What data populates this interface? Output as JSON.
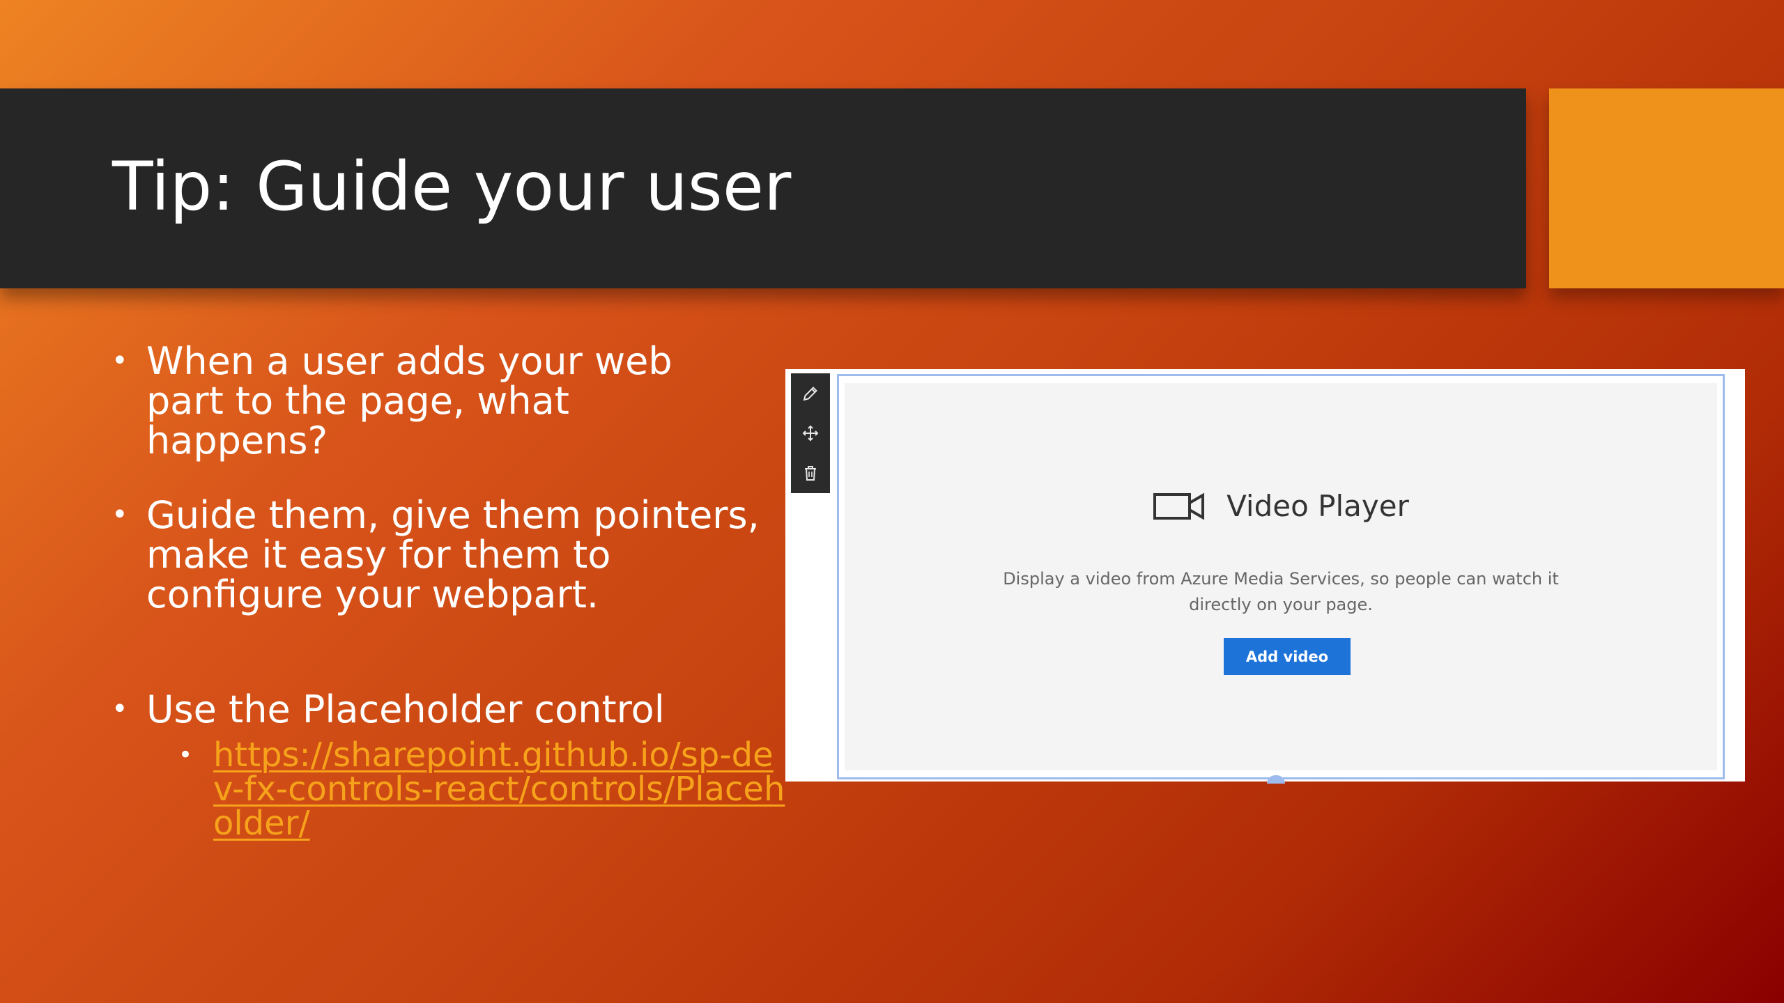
{
  "slide": {
    "title": "Tip: Guide your user",
    "colors": {
      "background_start": "#ee8323",
      "background_end": "#8a0000",
      "title_bar": "#262626",
      "accent_block": "#ef921b",
      "link": "#f7a21b"
    }
  },
  "bullets": [
    {
      "marker": "•",
      "text": "When a user adds your web part to the page, what happens?"
    },
    {
      "marker": "•",
      "text": "Guide them, give them pointers, make it easy for them to configure your webpart."
    },
    {
      "marker": "•",
      "text": "Use the Placeholder control"
    }
  ],
  "sub_bullet": {
    "marker": "•",
    "link_text": "https://sharepoint.github.io/sp-dev-fx-controls-react/controls/Placeholder/"
  },
  "screenshot": {
    "toolbar": {
      "icons": [
        "pencil-icon",
        "move-icon",
        "trash-icon"
      ]
    },
    "placeholder": {
      "icon": "video-camera-icon",
      "title": "Video Player",
      "description": "Display a video from Azure Media Services, so people can watch it directly on your page.",
      "button_label": "Add video",
      "button_color": "#1e73d9",
      "border_color": "#9dbbec"
    }
  }
}
